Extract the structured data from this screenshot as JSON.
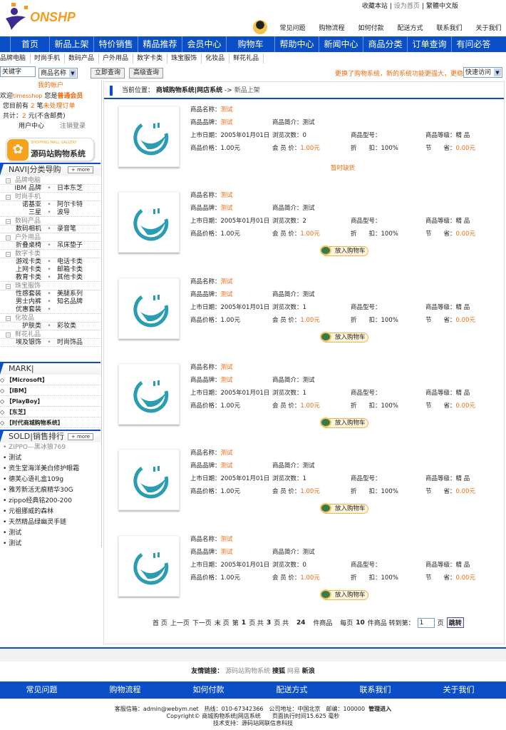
{
  "logo": {
    "text": "ONSHP"
  },
  "top_links": [
    "收藏本站",
    "设为首页",
    "繁體中文版"
  ],
  "help_nav": [
    "常见问题",
    "购物流程",
    "如何付款",
    "配送方式",
    "联系我们",
    "关于我们"
  ],
  "main_nav": [
    "首页",
    "新品上架",
    "特价销售",
    "精品推荐",
    "会员中心",
    "购物车",
    "帮助中心",
    "新闻中心",
    "商品分类",
    "订单查询",
    "有问必答"
  ],
  "category_bar": [
    "品牌电脑",
    "时尚手机",
    "数码产品",
    "户外用品",
    "数字卡类",
    "珠宝服饰",
    "化妆品",
    "鲜花礼品"
  ],
  "search": {
    "keyword_value": "关键字",
    "field_select": "商品名称",
    "search_button": "立即查询",
    "advanced_button": "高级查询",
    "notice": "更换了购物系统，新的系统功能更强大，更稳",
    "quick_select": "快速访问"
  },
  "account": {
    "title": "我的帐户",
    "welcome": "欢迎",
    "username": "timesshop",
    "you_are": "您是",
    "level": "普通会员",
    "pending_prefix": "您目前有",
    "pending_count": "2",
    "pending_mid": "笔",
    "pending_link": "未处理订单",
    "total_prefix": "共计：",
    "total_value": "2",
    "total_suffix": "元(不含邮费)",
    "user_center": "用户中心",
    "logout": "注销登录"
  },
  "banner": {
    "top": "SHOPPING MALL GALLERY",
    "main": "源码站购物系统"
  },
  "navi": {
    "title": "NAVI|分类导购",
    "more": "+ more",
    "groups": [
      {
        "name": "品牌电脑",
        "rows": [
          [
            "IBM 品牌",
            "日本东芝"
          ]
        ]
      },
      {
        "name": "时尚手机",
        "rows": [
          [
            "诺基亚",
            "阿尔卡特"
          ],
          [
            "三星",
            "波导"
          ]
        ]
      },
      {
        "name": "数码产品",
        "rows": [
          [
            "数码相机",
            "录音笔"
          ]
        ]
      },
      {
        "name": "户外用品",
        "rows": [
          [
            "折叠桌椅",
            "吊床垫子"
          ]
        ]
      },
      {
        "name": "数字卡类",
        "rows": [
          [
            "游戏卡类",
            "电话卡类"
          ],
          [
            "上网卡类",
            "邮箱卡类"
          ],
          [
            "教育卡类",
            "其他卡类"
          ]
        ]
      },
      {
        "name": "珠宝服饰",
        "rows": [
          [
            "性感套装",
            "美腿系列"
          ],
          [
            "男士内裤",
            "知名品牌"
          ],
          [
            "优惠套装",
            ""
          ]
        ]
      },
      {
        "name": "化妆品",
        "rows": [
          [
            "护肤类",
            "彩妆类"
          ]
        ]
      },
      {
        "name": "鲜花礼品",
        "rows": [
          [
            "埃及银饰",
            "时尚饰品"
          ]
        ]
      }
    ]
  },
  "mark": {
    "title": "MARK|",
    "items": [
      "【Microsoft】",
      "【IBM】",
      "【PlayBoy】",
      "【东芝】",
      "【时代商城购物系统】"
    ]
  },
  "sold": {
    "title": "SOLD|销售排行",
    "more": "+ more",
    "items": [
      "ZIPPO—黑冰狼769",
      "测试",
      "资生堂海洋美白修护眼霜",
      "德芙心语礼盒109g",
      "雅芳新活无痕精华30G",
      "zippo经典铭200-200",
      "元祖挪威的森林",
      "天然精品绿幽灵手链",
      "测试",
      "测试"
    ]
  },
  "breadcrumb": {
    "label": "当前位置：",
    "site": "商城购物系统|网店系统",
    "arrow": "->",
    "current": "新品上架"
  },
  "labels": {
    "name": "商品名称：",
    "brand": "商品品牌：",
    "intro": "商品简介：",
    "date": "上市日期：",
    "views": "浏览次数：",
    "model": "商品型号：",
    "grade": "商品等级：",
    "price": "商品价格：",
    "member": "会 员 价：",
    "discount": "折　　扣：",
    "save": "节　　省："
  },
  "products": [
    {
      "name": "测试",
      "brand": "测试",
      "intro": "测试",
      "date": "2005年01月01日",
      "views": "0",
      "model": "",
      "grade": "精 品",
      "price": "1.00元",
      "member": "1.00元",
      "discount": "100%",
      "save": "0.00元",
      "action": "暂时缺货"
    },
    {
      "name": "测试",
      "brand": "测试",
      "intro": "测试",
      "date": "2005年01月01日",
      "views": "2",
      "model": "",
      "grade": "精 品",
      "price": "1.00元",
      "member": "1.00元",
      "discount": "100%",
      "save": "0.00元",
      "action": "放入购物车"
    },
    {
      "name": "测试",
      "brand": "测试",
      "intro": "测试",
      "date": "2005年01月01日",
      "views": "1",
      "model": "",
      "grade": "精 品",
      "price": "1.00元",
      "member": "1.00元",
      "discount": "100%",
      "save": "0.00元",
      "action": "放入购物车"
    },
    {
      "name": "测试",
      "brand": "测试",
      "intro": "测试",
      "date": "2005年01月01日",
      "views": "1",
      "model": "",
      "grade": "精 品",
      "price": "1.00元",
      "member": "1.00元",
      "discount": "100%",
      "save": "0.00元",
      "action": "放入购物车"
    },
    {
      "name": "测试",
      "brand": "测试",
      "intro": "测试",
      "date": "2005年01月01日",
      "views": "1",
      "model": "",
      "grade": "精 品",
      "price": "1.00元",
      "member": "1.00元",
      "discount": "100%",
      "save": "0.00元",
      "action": "放入购物车"
    },
    {
      "name": "测试",
      "brand": "测试",
      "intro": "测试",
      "date": "2005年01月01日",
      "views": "0",
      "model": "",
      "grade": "精 品",
      "price": "1.00元",
      "member": "1.00元",
      "discount": "100%",
      "save": "0.00元",
      "action": "放入购物车"
    }
  ],
  "pager": {
    "first": "首 页",
    "prev": "上一页",
    "next": "下一页",
    "last": "末 页",
    "page_pre": "第",
    "page": "1",
    "page_mid": "页 共",
    "pages": "3",
    "page_suf": "页 共",
    "total": "24",
    "total_suf": "件商品",
    "per_pre": "每页",
    "per": "10",
    "per_suf": "件商品 转到第：",
    "goto_value": "1",
    "goto_suf": "页",
    "jump": "跳转"
  },
  "friends": {
    "label": "友情链接：",
    "links": [
      "源码站购物系统",
      "搜狐",
      "网易",
      "新浪"
    ]
  },
  "footer_nav": [
    "常见问题",
    "购物流程",
    "如何付款",
    "配送方式",
    "联系我们",
    "关于我们"
  ],
  "footer": {
    "line1": "客服信箱：admin@webym.net　热线：010-67342366　公司地址：中国北京　邮编：100000",
    "admin": "管理进入",
    "line2": "Copyright© 商城购物系统|网店系统　　页面执行时间15.625 毫秒",
    "line3": "技术支持：源码站网联信息科技"
  },
  "colors": {
    "brand_blue": "#0a4fc8",
    "accent_orange": "#f06a0a"
  }
}
